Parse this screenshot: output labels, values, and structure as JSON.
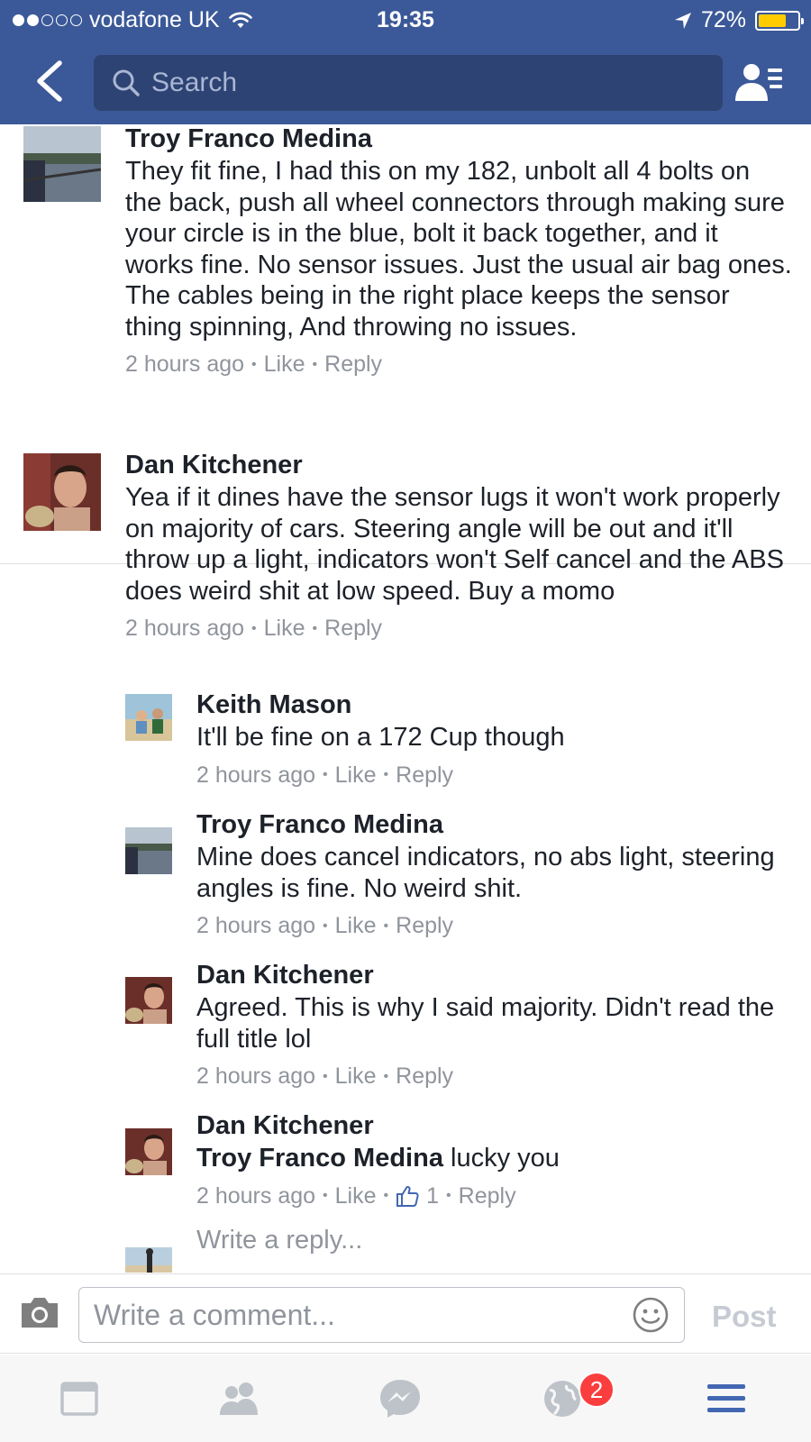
{
  "status_bar": {
    "carrier": "vodafone UK",
    "time": "19:35",
    "battery_percent": "72%",
    "battery_level": 0.72,
    "signal_dots_filled": 2,
    "signal_dots_total": 5,
    "battery_color": "#ffcc00"
  },
  "header": {
    "background": "#3b5998",
    "search_placeholder": "Search",
    "back_icon": "chevron-left-icon",
    "friends_icon": "friend-list-icon"
  },
  "comments": [
    {
      "author": "Troy Franco Medina",
      "text": "They fit fine, I had this on my 182, unbolt all 4 bolts on the back, push all wheel connectors through making sure your circle is in the blue, bolt it back together, and it works fine. No sensor issues. Just the usual air bag ones. The cables being in the right place keeps the sensor thing spinning, And throwing no issues.",
      "time": "2 hours ago",
      "like": "Like",
      "reply": "Reply"
    },
    {
      "author": "Dan Kitchener",
      "text": "Yea if it dines have the sensor lugs it won't work properly on majority of cars. Steering angle will be out and it'll throw up a light, indicators won't Self cancel and the ABS does weird shit at low speed. Buy a momo",
      "time": "2 hours ago",
      "like": "Like",
      "reply": "Reply"
    }
  ],
  "replies": [
    {
      "author": "Keith Mason",
      "text": "It'll be fine on a 172 Cup though",
      "time": "2 hours ago",
      "like": "Like",
      "reply": "Reply"
    },
    {
      "author": "Troy Franco Medina",
      "text": "Mine does cancel indicators, no abs light, steering angles is fine. No weird shit.",
      "time": "2 hours ago",
      "like": "Like",
      "reply": "Reply"
    },
    {
      "author": "Dan Kitchener",
      "text": "Agreed. This is why I said majority. Didn't read the full title lol",
      "time": "2 hours ago",
      "like": "Like",
      "reply": "Reply"
    },
    {
      "author": "Dan Kitchener",
      "mention": "Troy Franco Medina",
      "text": " lucky you",
      "time": "2 hours ago",
      "like": "Like",
      "like_count": "1",
      "reply": "Reply"
    }
  ],
  "write_reply_placeholder": "Write a reply...",
  "composer": {
    "placeholder": "Write a comment...",
    "post_label": "Post"
  },
  "tabbar": {
    "items": [
      "news-feed-icon",
      "friend-requests-icon",
      "messenger-icon",
      "notifications-globe-icon",
      "menu-icon"
    ],
    "notifications_badge": "2",
    "active_color": "#4267b2",
    "inactive_color": "#bec3c9"
  }
}
